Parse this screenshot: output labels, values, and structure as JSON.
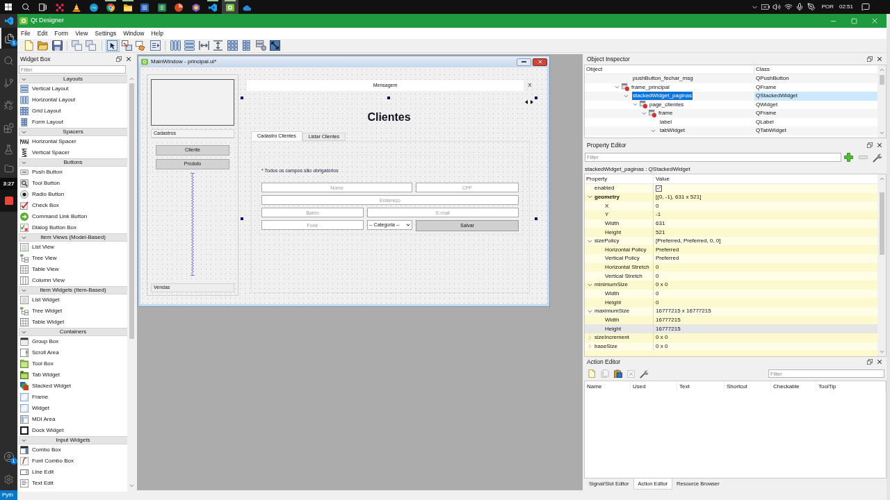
{
  "taskbar": {
    "apps": [
      {
        "running": false,
        "selected": false
      },
      {
        "running": false,
        "selected": false
      },
      {
        "running": false,
        "selected": false
      },
      {
        "running": true,
        "selected": false
      },
      {
        "running": true,
        "selected": false
      },
      {
        "running": false,
        "selected": false
      },
      {
        "running": false,
        "selected": false
      },
      {
        "running": false,
        "selected": false
      },
      {
        "running": false,
        "selected": false
      },
      {
        "running": true,
        "selected": false
      },
      {
        "running": true,
        "selected": true
      },
      {
        "running": false,
        "selected": false
      }
    ],
    "language": "POR",
    "time": "02:51"
  },
  "editor_sidebar": {
    "explorer_badge": "1",
    "accounts_badge": "1",
    "status": "Pyth"
  },
  "recorder": {
    "time": "3:27"
  },
  "window": {
    "title": "Qt Designer"
  },
  "menu": [
    "File",
    "Edit",
    "Form",
    "View",
    "Settings",
    "Window",
    "Help"
  ],
  "toolbar": {
    "modes": [
      {
        "selected": true
      },
      {
        "selected": false
      },
      {
        "selected": false
      },
      {
        "selected": false
      }
    ]
  },
  "widget_box": {
    "title": "Widget Box",
    "filter": {
      "placeholder": "Filter"
    },
    "groups": [
      {
        "name": "Layouts",
        "expanded": true,
        "items": [
          "Vertical Layout",
          "Horizontal Layout",
          "Grid Layout",
          "Form Layout"
        ]
      },
      {
        "name": "Spacers",
        "expanded": true,
        "items": [
          "Horizontal Spacer",
          "Vertical Spacer"
        ]
      },
      {
        "name": "Buttons",
        "expanded": true,
        "items": [
          "Push Button",
          "Tool Button",
          "Radio Button",
          "Check Box",
          "Command Link Button",
          "Dialog Button Box"
        ]
      },
      {
        "name": "Item Views (Model-Based)",
        "expanded": true,
        "items": [
          "List View",
          "Tree View",
          "Table View",
          "Column View"
        ]
      },
      {
        "name": "Item Widgets (Item-Based)",
        "expanded": true,
        "items": [
          "List Widget",
          "Tree Widget",
          "Table Widget"
        ]
      },
      {
        "name": "Containers",
        "expanded": true,
        "items": [
          "Group Box",
          "Scroll Area",
          "Tool Box",
          "Tab Widget",
          "Stacked Widget",
          "Frame",
          "Widget",
          "MDI Area",
          "Dock Widget"
        ]
      },
      {
        "name": "Input Widgets",
        "expanded": true,
        "items": [
          "Combo Box",
          "Font Combo Box",
          "Line Edit",
          "Text Edit"
        ]
      }
    ]
  },
  "form": {
    "title": "MainWindow - principal.ui*",
    "sidebar": {
      "pages": [
        {
          "label": "Cadastros",
          "selected": true,
          "buttons": [
            "Cliente",
            "Produto"
          ]
        },
        {
          "label": "Vendas",
          "selected": false
        }
      ]
    },
    "message": {
      "text": "Mensagem",
      "close": "X"
    },
    "heading": "Clientes",
    "tabs": [
      {
        "label": "Cadastro Clientes",
        "selected": true
      },
      {
        "label": "Listar Clientes",
        "selected": false
      }
    ],
    "note": "* Todos os campos são obrigatórios",
    "controls": [
      {
        "kind": "input",
        "placeholder": "Nome"
      },
      {
        "kind": "input",
        "placeholder": "CPF"
      },
      {
        "kind": "input",
        "placeholder": "Endereço"
      },
      {
        "kind": "input",
        "placeholder": "Bairro"
      },
      {
        "kind": "input",
        "placeholder": "E-mail"
      },
      {
        "kind": "input",
        "placeholder": "Fone"
      },
      {
        "kind": "combo",
        "value": "-- Categoria --"
      },
      {
        "kind": "button",
        "label": "Salvar"
      }
    ]
  },
  "object_inspector": {
    "title": "Object Inspector",
    "columns": [
      "Object",
      "Class"
    ],
    "rows": [
      {
        "children": [
          {
            "name": "pushButton_fechar_msg",
            "class": "QPushButton",
            "icon": false,
            "selected": false
          }
        ]
      },
      {
        "name": "frame_principal",
        "class": "QFrame",
        "icon": true,
        "selected": false,
        "expanded": true,
        "children": [
          {
            "name": "stackedWidget_paginas",
            "class": "QStackedWidget",
            "icon": false,
            "selected": true,
            "expanded": true,
            "children": [
              {
                "name": "page_clientes",
                "class": "QWidget",
                "icon": true,
                "selected": false,
                "expanded": true,
                "children": [
                  {
                    "name": "frame",
                    "class": "QFrame",
                    "icon": true,
                    "selected": false,
                    "expanded": true,
                    "children": [
                      {
                        "name": "label",
                        "class": "QLabel",
                        "icon": false,
                        "selected": false
                      },
                      {
                        "name": "tabWidget",
                        "class": "QTabWidget",
                        "icon": false,
                        "selected": false,
                        "expanded": true
                      }
                    ]
                  }
                ]
              }
            ]
          }
        ]
      }
    ]
  },
  "property_editor": {
    "title": "Property Editor",
    "filter": {
      "placeholder": "Filter"
    },
    "object": "stackedWidget_paginas : QStackedWidget",
    "columns": [
      "Property",
      "Value"
    ],
    "rows": [
      {
        "name": "enabled",
        "kind": "checkbox",
        "checked": true,
        "modified": false,
        "selected": false
      },
      {
        "name": "geometry",
        "kind": "text",
        "value": "[(0, -1), 631 x 521]",
        "modified": true,
        "selected": false,
        "expanded": true,
        "children": [
          {
            "name": "X",
            "value": "0",
            "selected": false
          },
          {
            "name": "Y",
            "value": "-1",
            "selected": false
          },
          {
            "name": "Width",
            "value": "631",
            "selected": false
          },
          {
            "name": "Height",
            "value": "521",
            "selected": false
          }
        ]
      },
      {
        "name": "sizePolicy",
        "kind": "text",
        "value": "[Preferred, Preferred, 0, 0]",
        "modified": false,
        "selected": false,
        "expanded": true,
        "children": [
          {
            "name": "Horizontal Policy",
            "value": "Preferred",
            "selected": false
          },
          {
            "name": "Vertical Policy",
            "value": "Preferred",
            "selected": false
          },
          {
            "name": "Horizontal Stretch",
            "value": "0",
            "selected": false
          },
          {
            "name": "Vertical Stretch",
            "value": "0",
            "selected": false
          }
        ]
      },
      {
        "name": "minimumSize",
        "kind": "text",
        "value": "0 x 0",
        "modified": false,
        "selected": false,
        "expanded": true,
        "children": [
          {
            "name": "Width",
            "value": "0",
            "selected": false
          },
          {
            "name": "Height",
            "value": "0",
            "selected": false
          }
        ]
      },
      {
        "name": "maximumSize",
        "kind": "text",
        "value": "16777215 x 16777215",
        "modified": false,
        "selected": false,
        "expanded": true,
        "children": [
          {
            "name": "Width",
            "value": "16777215",
            "selected": false
          },
          {
            "name": "Height",
            "value": "16777215",
            "selected": true
          }
        ]
      },
      {
        "name": "sizeIncrement",
        "kind": "text",
        "value": "0 x 0",
        "modified": false,
        "selected": false,
        "expanded": false
      },
      {
        "name": "baseSize",
        "kind": "text",
        "value": "0 x 0",
        "modified": false,
        "selected": false,
        "expanded": false
      }
    ]
  },
  "action_editor": {
    "title": "Action Editor",
    "filter": {
      "placeholder": "Filter"
    },
    "columns": [
      "Name",
      "Used",
      "Text",
      "Shortcut",
      "Checkable",
      "ToolTip"
    ]
  },
  "dock_tabs": [
    {
      "label": "Signal/Slot Editor",
      "selected": false
    },
    {
      "label": "Action Editor",
      "selected": true
    },
    {
      "label": "Resource Browser",
      "selected": false
    }
  ]
}
